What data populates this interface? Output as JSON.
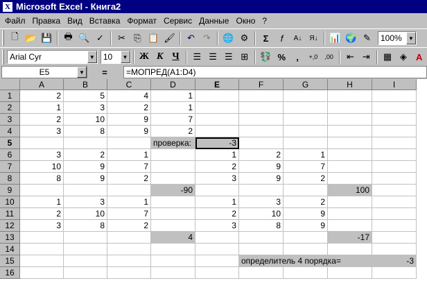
{
  "window": {
    "title": "Microsoft Excel - Книга2"
  },
  "menu": [
    "Файл",
    "Правка",
    "Вид",
    "Вставка",
    "Формат",
    "Сервис",
    "Данные",
    "Окно",
    "?"
  ],
  "toolbar1": {
    "buttons": [
      "new-icon",
      "open-icon",
      "save-icon",
      "print-icon",
      "print-preview-icon",
      "spellcheck-icon",
      "cut-icon",
      "copy-icon",
      "paste-icon",
      "format-painter-icon",
      "undo-icon",
      "redo-icon",
      "hyperlink-icon",
      "web-toolbar-icon",
      "autosum-icon",
      "function-icon",
      "sort-asc-icon",
      "sort-desc-icon",
      "chart-wizard-icon",
      "map-icon",
      "drawing-icon"
    ],
    "zoom": "100%"
  },
  "toolbar2": {
    "font": "Arial Cyr",
    "font_size": "10",
    "bold": "Ж",
    "italic": "К",
    "underline": "Ч",
    "percent": "%",
    "comma": ",",
    "inc_decimal": "+,0",
    "dec_decimal": ",00"
  },
  "formula_bar": {
    "cell_ref": "E5",
    "eq": "=",
    "formula": "=МОПРЕД(A1:D4)"
  },
  "sheet": {
    "columns": [
      "A",
      "B",
      "C",
      "D",
      "E",
      "F",
      "G",
      "H",
      "I"
    ],
    "rows": [
      "1",
      "2",
      "3",
      "4",
      "5",
      "6",
      "7",
      "8",
      "9",
      "10",
      "11",
      "12",
      "13",
      "14",
      "15",
      "16"
    ],
    "active_cell": "E5",
    "cells": [
      {
        "r": 0,
        "c": 0,
        "v": "2"
      },
      {
        "r": 0,
        "c": 1,
        "v": "5"
      },
      {
        "r": 0,
        "c": 2,
        "v": "4"
      },
      {
        "r": 0,
        "c": 3,
        "v": "1"
      },
      {
        "r": 1,
        "c": 0,
        "v": "1"
      },
      {
        "r": 1,
        "c": 1,
        "v": "3"
      },
      {
        "r": 1,
        "c": 2,
        "v": "2"
      },
      {
        "r": 1,
        "c": 3,
        "v": "1"
      },
      {
        "r": 2,
        "c": 0,
        "v": "2"
      },
      {
        "r": 2,
        "c": 1,
        "v": "10"
      },
      {
        "r": 2,
        "c": 2,
        "v": "9"
      },
      {
        "r": 2,
        "c": 3,
        "v": "7"
      },
      {
        "r": 3,
        "c": 0,
        "v": "3"
      },
      {
        "r": 3,
        "c": 1,
        "v": "8"
      },
      {
        "r": 3,
        "c": 2,
        "v": "9"
      },
      {
        "r": 3,
        "c": 3,
        "v": "2"
      },
      {
        "r": 4,
        "c": 3,
        "v": "проверка:",
        "t": "text",
        "shade": true
      },
      {
        "r": 4,
        "c": 4,
        "v": "-3",
        "shade": true
      },
      {
        "r": 5,
        "c": 0,
        "v": "3"
      },
      {
        "r": 5,
        "c": 1,
        "v": "2"
      },
      {
        "r": 5,
        "c": 2,
        "v": "1"
      },
      {
        "r": 5,
        "c": 4,
        "v": "1"
      },
      {
        "r": 5,
        "c": 5,
        "v": "2"
      },
      {
        "r": 5,
        "c": 6,
        "v": "1"
      },
      {
        "r": 6,
        "c": 0,
        "v": "10"
      },
      {
        "r": 6,
        "c": 1,
        "v": "9"
      },
      {
        "r": 6,
        "c": 2,
        "v": "7"
      },
      {
        "r": 6,
        "c": 4,
        "v": "2"
      },
      {
        "r": 6,
        "c": 5,
        "v": "9"
      },
      {
        "r": 6,
        "c": 6,
        "v": "7"
      },
      {
        "r": 7,
        "c": 0,
        "v": "8"
      },
      {
        "r": 7,
        "c": 1,
        "v": "9"
      },
      {
        "r": 7,
        "c": 2,
        "v": "2"
      },
      {
        "r": 7,
        "c": 4,
        "v": "3"
      },
      {
        "r": 7,
        "c": 5,
        "v": "9"
      },
      {
        "r": 7,
        "c": 6,
        "v": "2"
      },
      {
        "r": 8,
        "c": 3,
        "v": "-90",
        "shade": true
      },
      {
        "r": 8,
        "c": 7,
        "v": "100",
        "shade": true
      },
      {
        "r": 9,
        "c": 0,
        "v": "1"
      },
      {
        "r": 9,
        "c": 1,
        "v": "3"
      },
      {
        "r": 9,
        "c": 2,
        "v": "1"
      },
      {
        "r": 9,
        "c": 4,
        "v": "1"
      },
      {
        "r": 9,
        "c": 5,
        "v": "3"
      },
      {
        "r": 9,
        "c": 6,
        "v": "2"
      },
      {
        "r": 10,
        "c": 0,
        "v": "2"
      },
      {
        "r": 10,
        "c": 1,
        "v": "10"
      },
      {
        "r": 10,
        "c": 2,
        "v": "7"
      },
      {
        "r": 10,
        "c": 4,
        "v": "2"
      },
      {
        "r": 10,
        "c": 5,
        "v": "10"
      },
      {
        "r": 10,
        "c": 6,
        "v": "9"
      },
      {
        "r": 11,
        "c": 0,
        "v": "3"
      },
      {
        "r": 11,
        "c": 1,
        "v": "8"
      },
      {
        "r": 11,
        "c": 2,
        "v": "2"
      },
      {
        "r": 11,
        "c": 4,
        "v": "3"
      },
      {
        "r": 11,
        "c": 5,
        "v": "8"
      },
      {
        "r": 11,
        "c": 6,
        "v": "9"
      },
      {
        "r": 12,
        "c": 3,
        "v": "4",
        "shade": true
      },
      {
        "r": 12,
        "c": 7,
        "v": "-17",
        "shade": true
      },
      {
        "r": 14,
        "c": 5,
        "v": "определитель 4 порядка=",
        "t": "text",
        "shade": true,
        "span": 3
      },
      {
        "r": 14,
        "c": 8,
        "v": "-3",
        "shade": true
      }
    ]
  }
}
